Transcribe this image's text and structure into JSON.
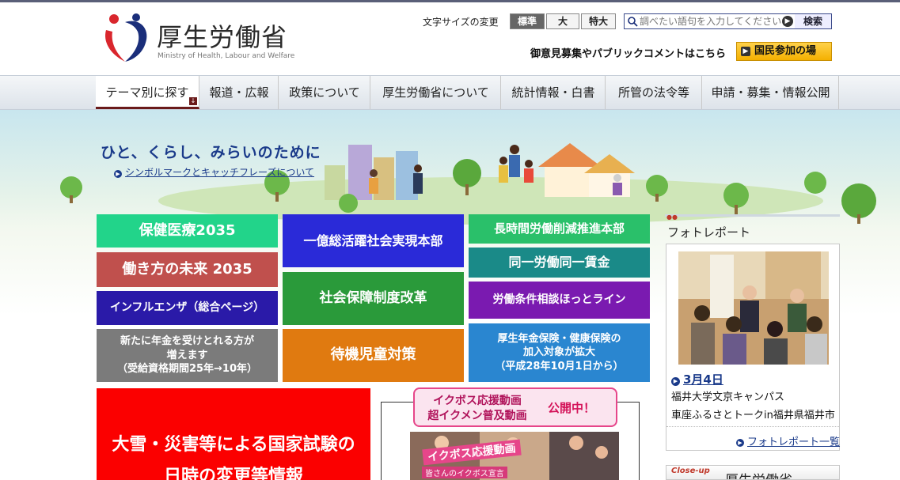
{
  "header": {
    "title": "厚生労働省",
    "subtitle": "Ministry of Health, Labour and Welfare",
    "font_size_label": "文字サイズの変更",
    "font_sizes": [
      "標準",
      "大",
      "特大"
    ],
    "search_placeholder": "調べたい語句を入力してください",
    "search_button": "検索",
    "public_comment": "御意見募集やパブリックコメントはこちら",
    "participation_button": "国民参加の場"
  },
  "nav": [
    "テーマ別に探す",
    "報道・広報",
    "政策について",
    "厚生労働省について",
    "統計情報・白書",
    "所管の法令等",
    "申請・募集・情報公開"
  ],
  "hero": {
    "catchphrase": "ひと、くらし、みらいのために",
    "catch_link": "シンボルマークとキャッチフレーズについて"
  },
  "tiles": {
    "hoken": "保健医療2035",
    "hatarakikata": "働き方の未来 2035",
    "influenza": "インフルエンザ（総合ページ）",
    "nenkin_1": "新たに年金を受けとれる方が",
    "nenkin_2": "増えます",
    "nenkin_3": "（受給資格期間25年→10年）",
    "ichioku": "一億総活躍社会実現本部",
    "shakai": "社会保障制度改革",
    "taiki": "待機児童対策",
    "choujikan": "長時間労働削減推進本部",
    "douitsu": "同一労働同一賃金",
    "roudou": "労働条件相談ほっとライン",
    "kousei_1": "厚生年金保険・健康保険の",
    "kousei_2": "加入対象が拡大",
    "kousei_3": "（平成28年10月1日から）",
    "ooyuki_1": "大雪・災害等による国家試験の",
    "ooyuki_2": "日時の変更等情報"
  },
  "ikuboss": {
    "line1": "イクボス応援動画",
    "line2": "超イクメン普及動画",
    "open": "公開中！",
    "video_title": "イクボス応援動画",
    "video_sub": "皆さんのイクボス宣言"
  },
  "photo_report": {
    "title": "フォトレポート",
    "date": "3月4日",
    "line1": "福井大学文京キャンパス",
    "line2": "車座ふるさとトークin福井県福井市",
    "more": "フォトレポート一覧"
  },
  "closeup": {
    "label": "Close-up",
    "text": "厚生労働省"
  },
  "colors": {
    "hoken": "#22d48a",
    "hatarakikata": "#c0504d",
    "influenza": "#2a1aa8",
    "nenkin": "#7b7b7b",
    "ichioku": "#2a2ad8",
    "shakai": "#2a9a3a",
    "taiki": "#e07a10",
    "choujikan": "#2ac06a",
    "douitsu": "#1a8a88",
    "roudou": "#7a1ab0",
    "kousei": "#2a86d0",
    "ooyuki": "#fb0000"
  }
}
